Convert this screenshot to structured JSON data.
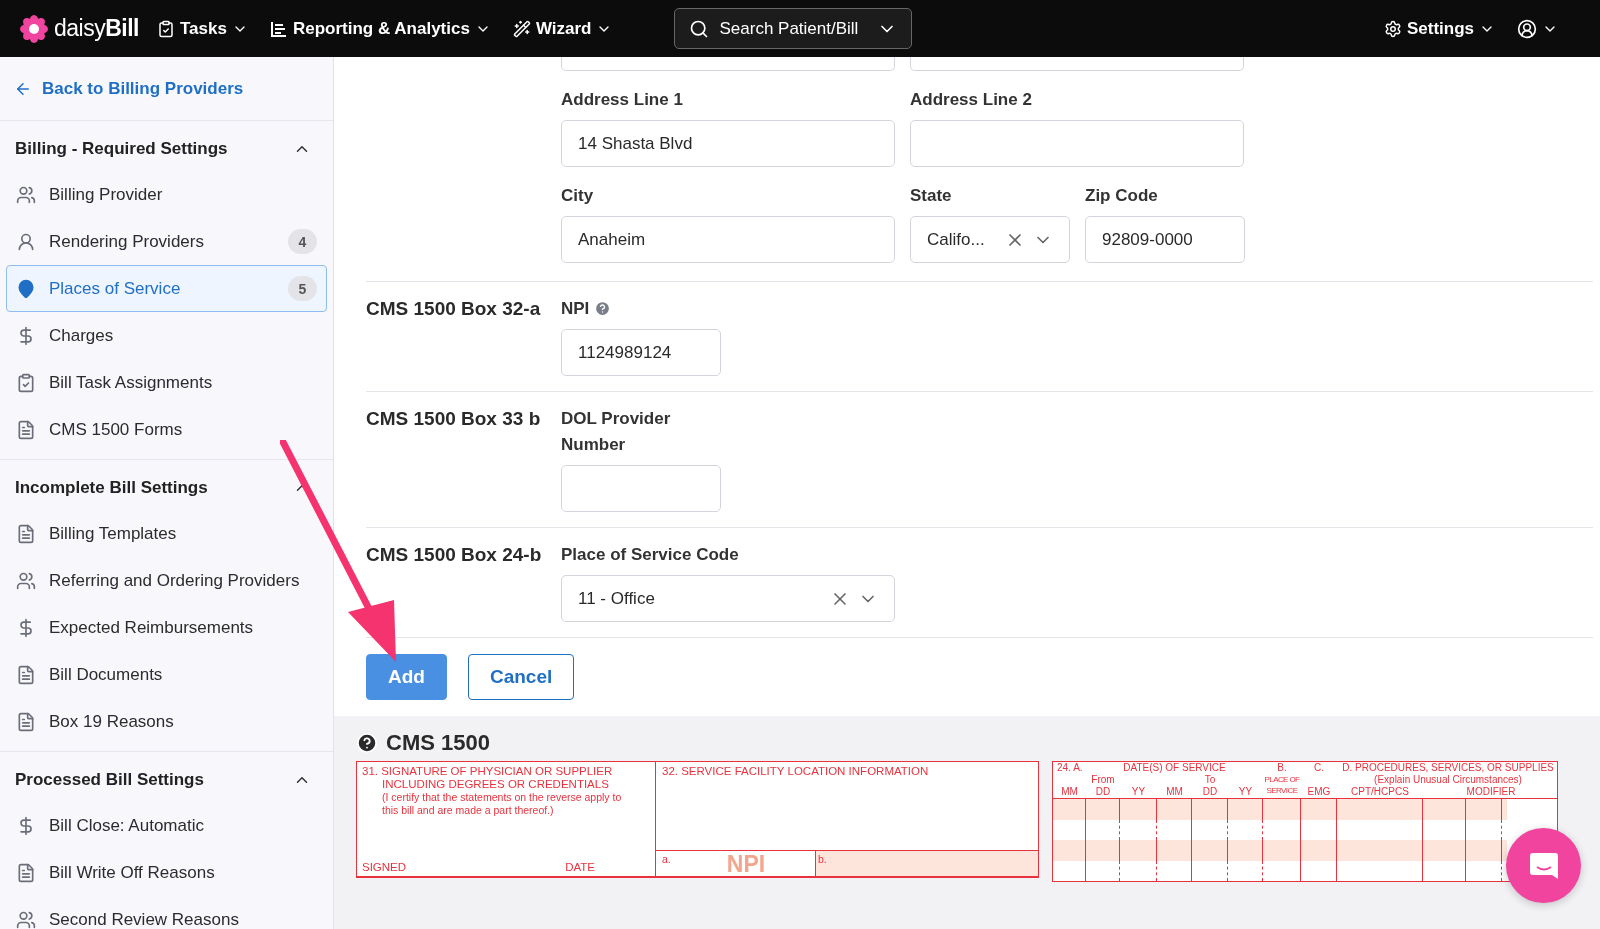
{
  "topbar": {
    "logo": "daisy**Bill**",
    "menus": [
      {
        "label": "Tasks",
        "kind": "tasks"
      },
      {
        "label": "Reporting & Analytics",
        "kind": "reports"
      },
      {
        "label": "Wizard",
        "kind": "wizard"
      }
    ],
    "search": {
      "placeholder": "Search Patient/Bill"
    },
    "settings": {
      "label": "Settings"
    }
  },
  "sidebar": {
    "back_link": "Back to Billing Providers",
    "sections": [
      {
        "title": "Billing - Required Settings",
        "expanded": true,
        "items": [
          {
            "label": "Billing Provider",
            "kind": "group",
            "selected": false
          },
          {
            "label": "Rendering Providers",
            "kind": "person-chat",
            "selected": false,
            "badge": "4"
          },
          {
            "label": "Places of Service",
            "kind": "location",
            "selected": true,
            "badge": "5"
          },
          {
            "label": "Charges",
            "kind": "dollar",
            "selected": false
          },
          {
            "label": "Bill Task Assignments",
            "kind": "clipboard",
            "selected": false
          },
          {
            "label": "CMS 1500 Forms",
            "kind": "document",
            "selected": false
          }
        ]
      },
      {
        "title": "Incomplete Bill Settings",
        "expanded": true,
        "items": [
          {
            "label": "Billing Templates",
            "kind": "document",
            "selected": false
          },
          {
            "label": "Referring and Ordering Providers",
            "kind": "group",
            "selected": false
          },
          {
            "label": "Expected Reimbursements",
            "kind": "dollar",
            "selected": false
          },
          {
            "label": "Bill Documents",
            "kind": "document",
            "selected": false
          },
          {
            "label": "Box 19 Reasons",
            "kind": "document",
            "selected": false
          }
        ]
      },
      {
        "title": "Processed Bill Settings",
        "expanded": true,
        "items": [
          {
            "label": "Bill Close: Automatic",
            "kind": "dollar",
            "selected": false
          },
          {
            "label": "Bill Write Off Reasons",
            "kind": "document",
            "selected": false
          },
          {
            "label": "Second Review Reasons",
            "kind": "group",
            "selected": false
          }
        ]
      }
    ]
  },
  "form": {
    "groups": [
      {
        "rows": [
          [
            {
              "label": "Address Line 1",
              "value": "14 Shasta Blvd",
              "kind": "text"
            },
            {
              "label": "Address Line 2",
              "kind": "text"
            }
          ],
          [
            {
              "label": "City",
              "value": "Anaheim",
              "kind": "text"
            },
            {
              "label": "State",
              "value": "Califo...",
              "kind": "select"
            },
            {
              "label": "Zip Code",
              "value": "92809-0000",
              "kind": "text"
            }
          ]
        ]
      },
      {
        "heading": "CMS 1500 Box 32-a",
        "rows": [
          [
            {
              "label": "NPI",
              "help": true,
              "value": "1124989124",
              "kind": "text"
            }
          ]
        ]
      },
      {
        "heading": "CMS 1500 Box 33 b",
        "rows": [
          [
            {
              "label": "DOL Provider Number",
              "kind": "text"
            }
          ]
        ]
      },
      {
        "heading": "CMS 1500 Box 24-b",
        "rows": [
          [
            {
              "label": "Place of Service Code",
              "value": "11 - Office",
              "kind": "select"
            }
          ]
        ]
      }
    ],
    "buttons": [
      {
        "label": "Add",
        "kind": "primary"
      },
      {
        "label": "Cancel",
        "kind": "secondary"
      }
    ]
  },
  "cms_preview": {
    "title": "CMS 1500",
    "box31": {
      "heading": "31. SIGNATURE OF PHYSICIAN OR SUPPLIER INCLUDING DEGREES OR CREDENTIALS",
      "note": "(I certify that the statements on the reverse apply to this bill and are made a part thereof.)",
      "signed": "SIGNED",
      "date": "DATE"
    },
    "box32": {
      "heading": "32. SERVICE FACILITY LOCATION INFORMATION",
      "a": "a.",
      "npi": "NPI",
      "b": "b."
    },
    "box24": {
      "header": [
        "24. A.",
        "DATE(S) OF SERVICE",
        "B.",
        "C.",
        "D. PROCEDURES, SERVICES, OR SUPPLIES",
        "From",
        "To",
        "PLACE OF SERVICE",
        "(Explain Unusual Circumstances)",
        "MM",
        "DD",
        "YY",
        "MM",
        "DD",
        "YY",
        "EMG",
        "CPT/HCPCS",
        "MODIFIER"
      ]
    }
  }
}
